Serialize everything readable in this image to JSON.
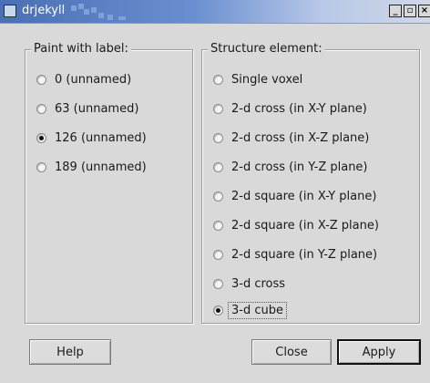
{
  "window": {
    "title": "drjekyll",
    "controls": [
      {
        "name": "minimize-icon",
        "glyph": "_"
      },
      {
        "name": "maximize-icon",
        "glyph": "▫"
      },
      {
        "name": "close-icon",
        "glyph": "×"
      }
    ]
  },
  "paint_group": {
    "title": "Paint with label:",
    "options": [
      {
        "label": "0 (unnamed)",
        "checked": false
      },
      {
        "label": "63 (unnamed)",
        "checked": false
      },
      {
        "label": "126 (unnamed)",
        "checked": true
      },
      {
        "label": "189 (unnamed)",
        "checked": false
      }
    ]
  },
  "structure_group": {
    "title": "Structure element:",
    "options": [
      {
        "label": "Single voxel",
        "checked": false
      },
      {
        "label": "2-d cross (in X-Y plane)",
        "checked": false
      },
      {
        "label": "2-d cross (in X-Z plane)",
        "checked": false
      },
      {
        "label": "2-d cross (in Y-Z plane)",
        "checked": false
      },
      {
        "label": "2-d square (in X-Y plane)",
        "checked": false
      },
      {
        "label": "2-d square (in X-Z plane)",
        "checked": false
      },
      {
        "label": "2-d square (in Y-Z plane)",
        "checked": false
      },
      {
        "label": "3-d cross",
        "checked": false
      },
      {
        "label": "3-d cube",
        "checked": true
      }
    ]
  },
  "buttons": {
    "help": "Help",
    "close": "Close",
    "apply": "Apply"
  }
}
